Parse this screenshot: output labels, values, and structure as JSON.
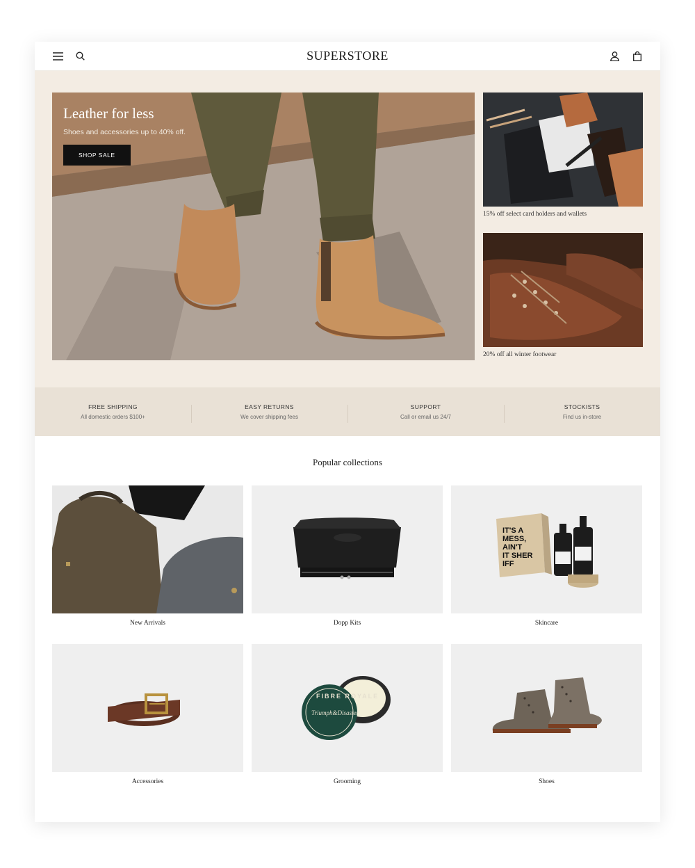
{
  "header": {
    "logo": "SUPERSTORE",
    "icons": [
      "menu-icon",
      "search-icon",
      "account-icon",
      "cart-icon"
    ]
  },
  "hero": {
    "title": "Leather for less",
    "subtitle": "Shoes and accessories up to 40% off.",
    "button_label": "SHOP SALE"
  },
  "promos": [
    {
      "caption": "15% off select card holders and wallets"
    },
    {
      "caption": "20% off all winter footwear"
    }
  ],
  "features": [
    {
      "title": "FREE SHIPPING",
      "subtitle": "All domestic orders $100+"
    },
    {
      "title": "EASY RETURNS",
      "subtitle": "We cover shipping fees"
    },
    {
      "title": "SUPPORT",
      "subtitle": "Call or email us 24/7"
    },
    {
      "title": "STOCKISTS",
      "subtitle": "Find us in-store"
    }
  ],
  "collections": {
    "title": "Popular collections",
    "items": [
      {
        "label": "New Arrivals"
      },
      {
        "label": "Dopp Kits"
      },
      {
        "label": "Skincare"
      },
      {
        "label": "Accessories"
      },
      {
        "label": "Grooming"
      },
      {
        "label": "Shoes"
      }
    ]
  },
  "product_art_text": {
    "skincare_box": [
      "IT'S A",
      "MESS,",
      "AIN'T",
      "IT SHER",
      "IFF"
    ],
    "grooming_tin_ring": "FIBRE ROYALE",
    "grooming_tin_brand": "Triumph&Disaster"
  },
  "colors": {
    "hero_bg": "#f3ece3",
    "features_bg": "#e9e1d6",
    "button_bg": "#111111",
    "card_bg": "#efefef"
  }
}
